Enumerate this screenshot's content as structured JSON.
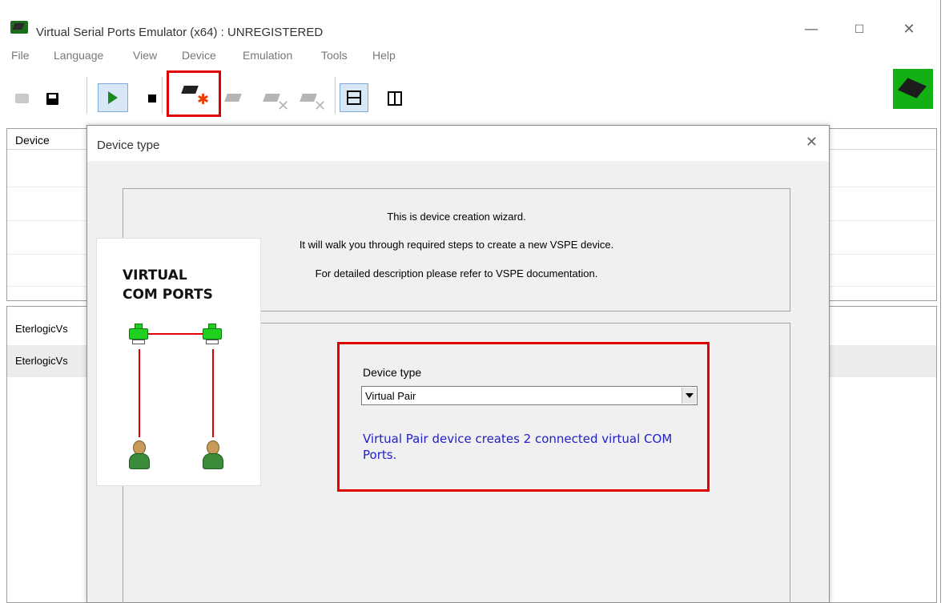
{
  "window": {
    "title": "Virtual Serial Ports Emulator (x64) : UNREGISTERED",
    "minimize": "—",
    "maximize": "☐",
    "close": "✕"
  },
  "menu": {
    "items": [
      "File",
      "Language",
      "View",
      "Device",
      "Emulation",
      "Tools",
      "Help"
    ]
  },
  "toolbar": {
    "buttons": [
      "open-icon",
      "save-icon",
      "start-emulation-icon",
      "stop-emulation-icon",
      "create-device-icon",
      "device-properties-icon",
      "delete-device-icon",
      "remove-device-icon",
      "layout-horizontal-icon",
      "layout-vertical-icon"
    ]
  },
  "device_list": {
    "header": "Device",
    "rows": [
      "EterlogicVs",
      "EterlogicVs"
    ]
  },
  "dialog": {
    "title": "Device type",
    "close": "✕",
    "intro": [
      "This is device creation wizard.",
      "It will walk you through required steps to create a new VSPE device.",
      "For detailed description please refer to VSPE documentation."
    ],
    "illustration_title_line1": "VIRTUAL",
    "illustration_title_line2": "COM PORTS",
    "device_type_label": "Device type",
    "device_type_value": "Virtual Pair",
    "device_description": "Virtual Pair device creates 2 connected virtual COM Ports."
  },
  "colors": {
    "highlight": "#e00000",
    "description_text": "#2121c7",
    "port_green": "#1fd01f"
  }
}
